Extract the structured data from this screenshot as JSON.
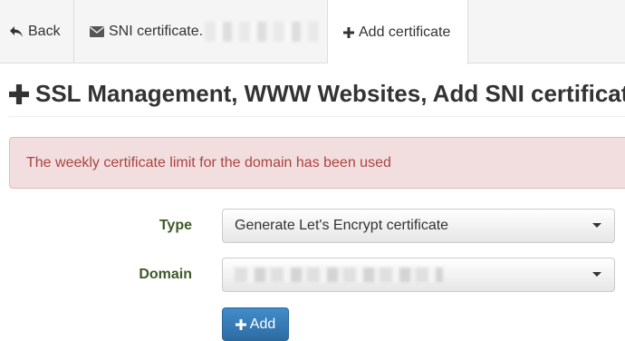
{
  "tabs": {
    "back_label": "Back",
    "sni_label": "SNI certificate.",
    "add_label": "Add certificate"
  },
  "page": {
    "title": "SSL Management, WWW Websites, Add SNI certificate"
  },
  "alert": {
    "message": "The weekly certificate limit for the domain has been used"
  },
  "form": {
    "type_label": "Type",
    "type_value": "Generate Let's Encrypt certificate",
    "domain_label": "Domain",
    "domain_value": "",
    "add_button_label": "Add"
  },
  "colors": {
    "alert_bg": "#f2dede",
    "alert_text": "#a94442",
    "label_text": "#3c5a28",
    "primary_button": "#337ab7"
  },
  "icons": {
    "back": "back-arrow-icon",
    "sni": "envelope-icon",
    "add_tab": "plus-icon",
    "title": "plus-icon",
    "add_button": "plus-icon"
  }
}
